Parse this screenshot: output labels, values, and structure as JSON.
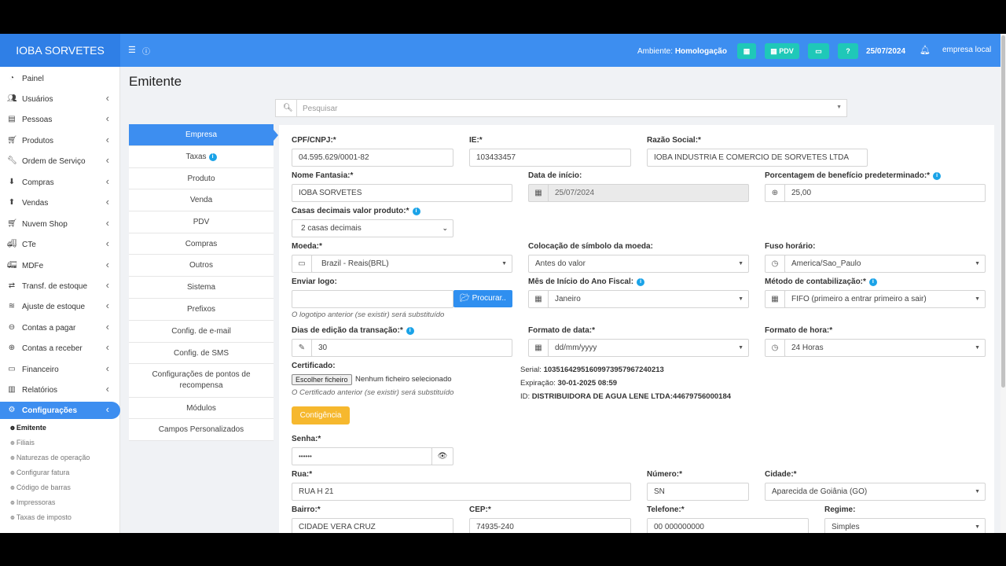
{
  "topbar": {
    "brand": "IOBA SORVETES",
    "env_label": "Ambiente:",
    "env_value": "Homologação",
    "pdv_label": "PDV",
    "date": "25/07/2024",
    "user": "empresa local"
  },
  "sidebar": {
    "items": [
      {
        "label": "Painel",
        "icon": "dashboard-icon"
      },
      {
        "label": "Usuários",
        "icon": "users-icon"
      },
      {
        "label": "Pessoas",
        "icon": "id-card-icon"
      },
      {
        "label": "Produtos",
        "icon": "cart-icon"
      },
      {
        "label": "Ordem de Serviço",
        "icon": "wrench-icon"
      },
      {
        "label": "Compras",
        "icon": "download-icon"
      },
      {
        "label": "Vendas",
        "icon": "upload-icon"
      },
      {
        "label": "Nuvem Shop",
        "icon": "shopping-cart-icon"
      },
      {
        "label": "CTe",
        "icon": "truck-icon"
      },
      {
        "label": "MDFe",
        "icon": "truck-loading-icon"
      },
      {
        "label": "Transf. de estoque",
        "icon": "shuffle-icon"
      },
      {
        "label": "Ajuste de estoque",
        "icon": "layers-icon"
      },
      {
        "label": "Contas a pagar",
        "icon": "minus-circle-icon"
      },
      {
        "label": "Contas a receber",
        "icon": "plus-circle-icon"
      },
      {
        "label": "Financeiro",
        "icon": "money-icon"
      },
      {
        "label": "Relatórios",
        "icon": "bar-chart-icon"
      },
      {
        "label": "Configurações",
        "icon": "gear-icon"
      }
    ],
    "subitems": [
      "Emitente",
      "Filiais",
      "Naturezas de operação",
      "Configurar fatura",
      "Código de barras",
      "Impressoras",
      "Taxas de imposto"
    ]
  },
  "page": {
    "title": "Emitente",
    "search_placeholder": "Pesquisar"
  },
  "tabs": [
    "Empresa",
    "Taxas",
    "Produto",
    "Venda",
    "PDV",
    "Compras",
    "Outros",
    "Sistema",
    "Prefixos",
    "Config. de e-mail",
    "Config. de SMS",
    "Configurações de pontos de recompensa",
    "Módulos",
    "Campos Personalizados"
  ],
  "form": {
    "cpf_label": "CPF/CNPJ:*",
    "cpf_value": "04.595.629/0001-82",
    "ie_label": "IE:*",
    "ie_value": "103433457",
    "razao_label": "Razão Social:*",
    "razao_value": "IOBA INDUSTRIA E COMERCIO DE SORVETES LTDA",
    "fantasia_label": "Nome Fantasia:*",
    "fantasia_value": "IOBA SORVETES",
    "data_inicio_label": "Data de início:",
    "data_inicio_value": "25/07/2024",
    "beneficio_label": "Porcentagem de benefício predeterminado:*",
    "beneficio_value": "25,00",
    "casas_label": "Casas decimais valor produto:*",
    "casas_value": "2 casas decimais",
    "moeda_label": "Moeda:*",
    "moeda_value": "Brazil - Reais(BRL)",
    "simbolo_label": "Colocação de símbolo da moeda:",
    "simbolo_value": "Antes do valor",
    "fuso_label": "Fuso horário:",
    "fuso_value": "America/Sao_Paulo",
    "logo_label": "Enviar logo:",
    "procurar_label": "Procurar..",
    "logo_hint": "O logotipo anterior (se existir) será substituído",
    "mes_label": "Mês de Início do Ano Fiscal:",
    "mes_value": "Janeiro",
    "metodo_label": "Método de contabilização:*",
    "metodo_value": "FIFO (primeiro a entrar primeiro a sair)",
    "dias_label": "Dias de edição da transação:*",
    "dias_value": "30",
    "formato_data_label": "Formato de data:*",
    "formato_data_value": "dd/mm/yyyy",
    "formato_hora_label": "Formato de hora:*",
    "formato_hora_value": "24 Horas",
    "cert_label": "Certificado:",
    "cert_button": "Escolher ficheiro",
    "cert_none": "Nenhum ficheiro selecionado",
    "cert_hint": "O Certificado anterior (se existir) será substituído",
    "serial_label": "Serial:",
    "serial_value": "10351642951609973957967240213",
    "expiracao_label": "Expiração:",
    "expiracao_value": "30-01-2025 08:59",
    "id_label": "ID:",
    "id_value": "DISTRIBUIDORA DE AGUA LENE LTDA:44679756000184",
    "contingencia_label": "Contigência",
    "senha_label": "Senha:*",
    "senha_value": "••••••",
    "rua_label": "Rua:*",
    "rua_value": "RUA H 21",
    "numero_label": "Número:*",
    "numero_value": "SN",
    "cidade_label": "Cidade:*",
    "cidade_value": "Aparecida de Goiânia (GO)",
    "bairro_label": "Bairro:*",
    "bairro_value": "CIDADE VERA CRUZ",
    "cep_label": "CEP:*",
    "cep_value": "74935-240",
    "telefone_label": "Telefone:*",
    "telefone_value": "00 000000000",
    "regime_label": "Regime:",
    "regime_value": "Simples"
  },
  "colors": {
    "primary": "#3d8ef0",
    "teal": "#1fc8b8",
    "warning": "#f6b82e"
  }
}
